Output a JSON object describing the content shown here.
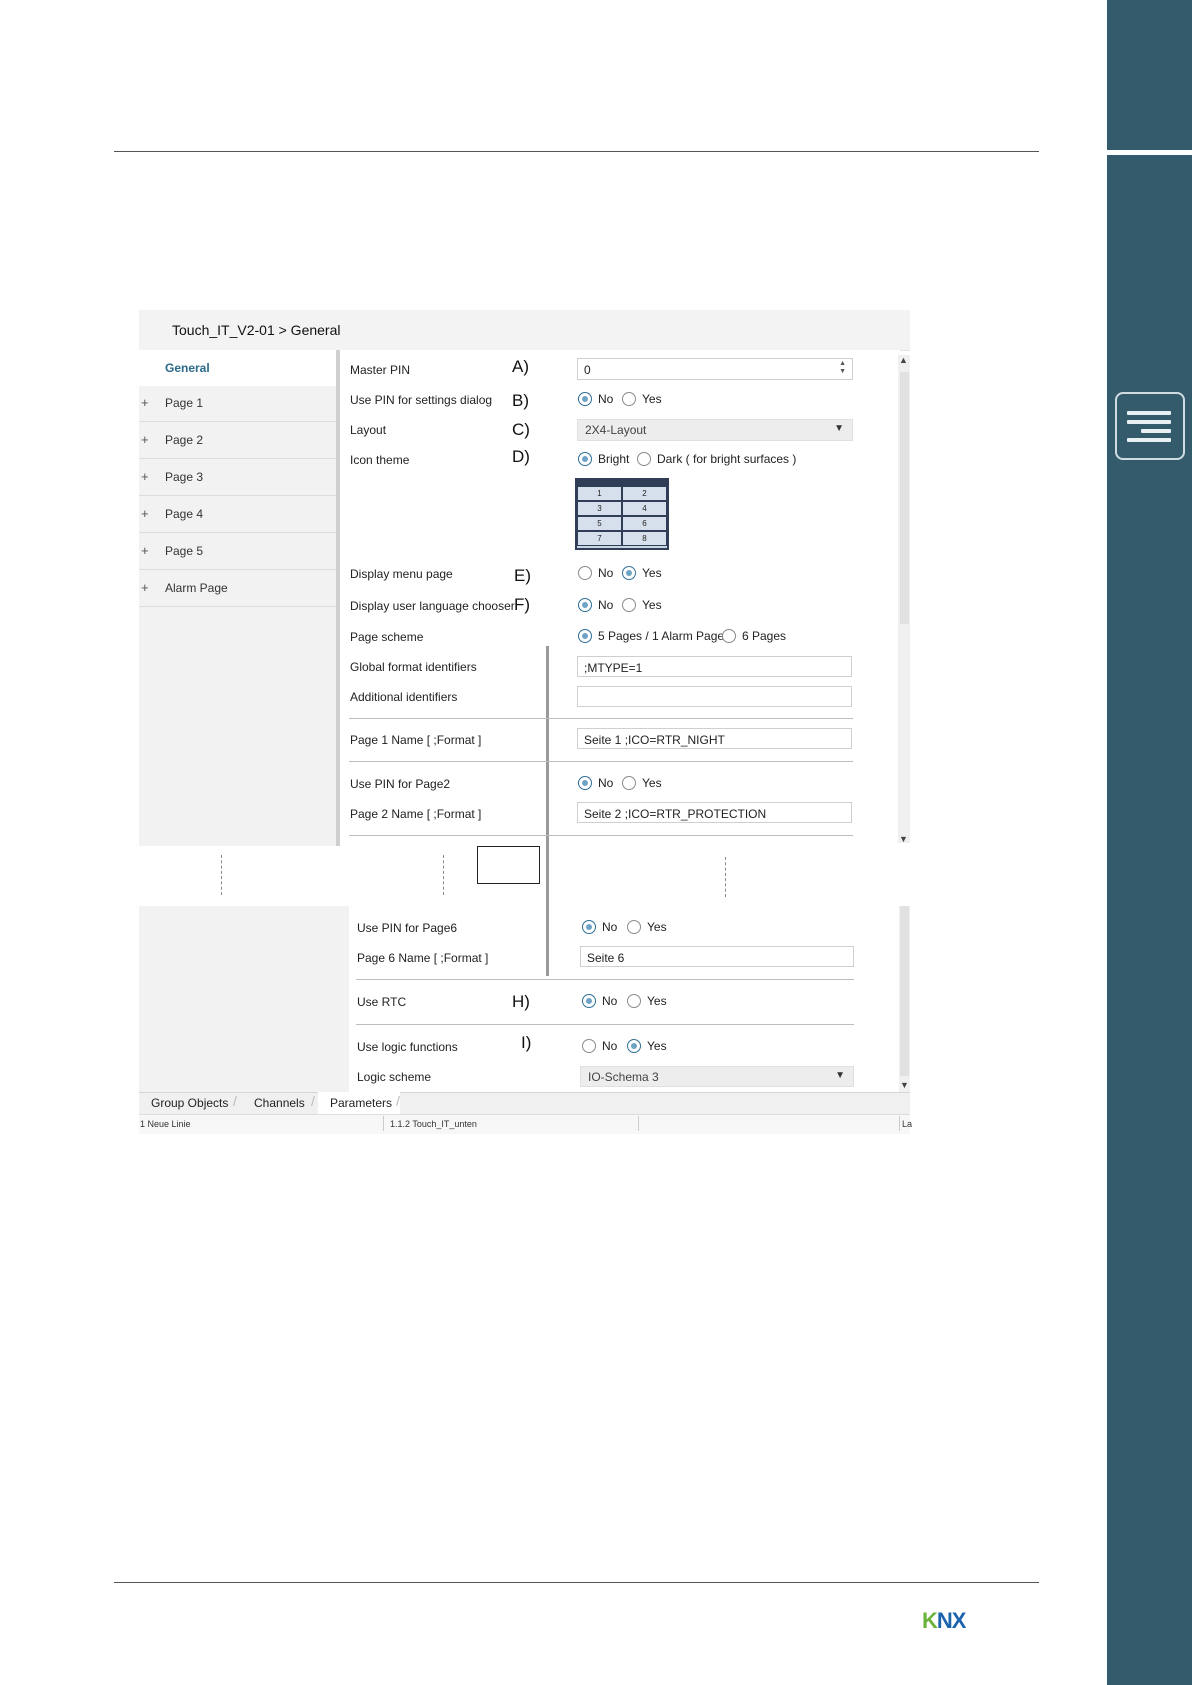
{
  "window": {
    "title": "Touch_IT_V2-01 > General"
  },
  "nav": {
    "active": "General",
    "items": [
      "Page 1",
      "Page 2",
      "Page 3",
      "Page 4",
      "Page 5",
      "Alarm Page"
    ],
    "expand_symbol": "+"
  },
  "params": {
    "master_pin": {
      "label": "Master PIN",
      "marker": "A)",
      "value": "0"
    },
    "use_pin_settings": {
      "label": "Use PIN for settings dialog",
      "marker": "B)",
      "options": [
        "No",
        "Yes"
      ],
      "selected": "No"
    },
    "layout": {
      "label": "Layout",
      "marker": "C)",
      "value": "2X4-Layout"
    },
    "icon_theme": {
      "label": "Icon theme",
      "marker": "D)",
      "options": [
        "Bright",
        "Dark ( for bright surfaces )"
      ],
      "selected": "Bright"
    },
    "layout_preview_cells": [
      "1",
      "2",
      "3",
      "4",
      "5",
      "6",
      "7",
      "8"
    ],
    "display_menu_page": {
      "label": "Display menu page",
      "marker": "E)",
      "options": [
        "No",
        "Yes"
      ],
      "selected": "Yes"
    },
    "display_language_chooser": {
      "label": "Display user language chooser",
      "marker": "F)",
      "options": [
        "No",
        "Yes"
      ],
      "selected": "No"
    },
    "page_scheme": {
      "label": "Page scheme",
      "options": [
        "5 Pages / 1 Alarm Page",
        "6 Pages"
      ],
      "selected": "5 Pages / 1 Alarm Page"
    },
    "global_format": {
      "label": "Global format identifiers",
      "value": ";MTYPE=1"
    },
    "additional_identifiers": {
      "label": "Additional identifiers",
      "value": ""
    },
    "page1_name": {
      "label": "Page 1 Name [ ;Format ]",
      "value": "Seite 1 ;ICO=RTR_NIGHT"
    },
    "use_pin_page2": {
      "label": "Use PIN for Page2",
      "options": [
        "No",
        "Yes"
      ],
      "selected": "No"
    },
    "page2_name": {
      "label": "Page 2 Name [ ;Format ]",
      "value": "Seite 2 ;ICO=RTR_PROTECTION"
    },
    "use_pin_page6": {
      "label": "Use PIN for Page6",
      "options": [
        "No",
        "Yes"
      ],
      "selected": "No"
    },
    "page6_name": {
      "label": "Page 6 Name [ ;Format ]",
      "value": "Seite 6"
    },
    "use_rtc": {
      "label": "Use RTC",
      "marker": "H)",
      "options": [
        "No",
        "Yes"
      ],
      "selected": "No"
    },
    "use_logic": {
      "label": "Use logic functions",
      "marker": "I)",
      "options": [
        "No",
        "Yes"
      ],
      "selected": "Yes"
    },
    "logic_scheme": {
      "label": "Logic scheme",
      "value": "IO-Schema 3"
    }
  },
  "tabs": [
    "Group Objects",
    "Channels",
    "Parameters"
  ],
  "active_tab": "Parameters",
  "status": [
    "1 Neue Linie",
    "1.1.2 Touch_IT_unten",
    "La"
  ],
  "logo": {
    "text_k": "K",
    "text_nx": "NX"
  },
  "colors": {
    "sidebar": "#345b6b",
    "accent": "#2b6a8a",
    "knx_green": "#6bb33c",
    "knx_blue": "#1d63ad"
  }
}
